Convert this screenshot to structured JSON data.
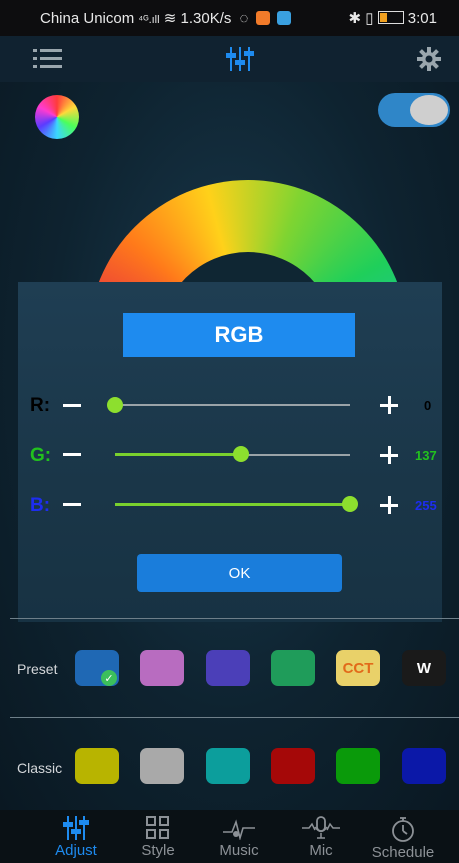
{
  "status_bar": {
    "carrier": "China Unicom",
    "signal": "ᴴᴸ.ııı",
    "speed": "1.30K/s",
    "time": "3:01"
  },
  "toolbar": {
    "menu_icon": "menu-icon",
    "center_icon": "equalizer-icon",
    "settings_icon": "gear-icon"
  },
  "main": {
    "power_toggle_on": true
  },
  "dialog": {
    "title": "RGB",
    "ok_label": "OK",
    "sliders": [
      {
        "label": "R:",
        "value": "0",
        "level": 0,
        "color": "#000000"
      },
      {
        "label": "G:",
        "value": "137",
        "level": 0.537,
        "color": "#22c11e"
      },
      {
        "label": "B:",
        "value": "255",
        "level": 1,
        "color": "#1d2df0"
      }
    ]
  },
  "preset": {
    "label": "Preset",
    "swatches": [
      {
        "color": "#1f68b4",
        "text": "",
        "selected": true
      },
      {
        "color": "#b86cc0",
        "text": ""
      },
      {
        "color": "#4b3fb8",
        "text": ""
      },
      {
        "color": "#1f9c5a",
        "text": ""
      },
      {
        "color": "#e9d169",
        "text": "CCT",
        "text_color": "#e26a1a"
      },
      {
        "color": "#1a1a1a",
        "text": "W",
        "text_color": "#ffffff"
      }
    ]
  },
  "classic": {
    "label": "Classic",
    "swatches": [
      {
        "color": "#b8b400"
      },
      {
        "color": "#a9a9a9"
      },
      {
        "color": "#0c9e9c"
      },
      {
        "color": "#a50808"
      },
      {
        "color": "#0a9a0a"
      },
      {
        "color": "#0b18a8"
      }
    ]
  },
  "bottom_nav": {
    "active_color": "#1e8bef",
    "items": [
      {
        "label": "Adjust",
        "icon": "equalizer-icon",
        "active": true
      },
      {
        "label": "Style",
        "icon": "grid-icon"
      },
      {
        "label": "Music",
        "icon": "music-icon"
      },
      {
        "label": "Mic",
        "icon": "mic-icon"
      },
      {
        "label": "Schedule",
        "icon": "stopwatch-icon"
      }
    ]
  }
}
